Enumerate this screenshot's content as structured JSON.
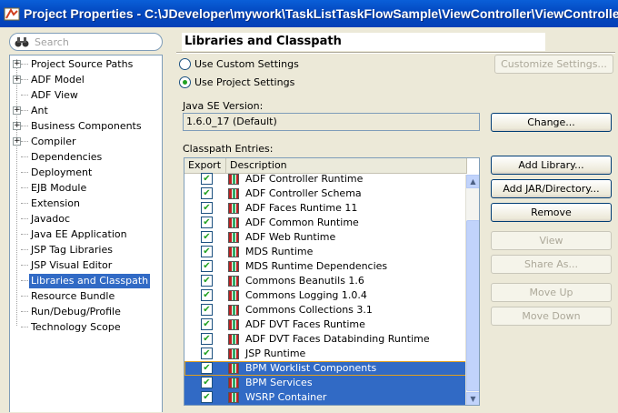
{
  "window": {
    "title": "Project Properties - C:\\JDeveloper\\mywork\\TaskListTaskFlowSample\\ViewController\\ViewController.jpr"
  },
  "search": {
    "placeholder": "Search"
  },
  "tree": [
    {
      "label": "Project Source Paths",
      "expandable": true
    },
    {
      "label": "ADF Model",
      "expandable": true
    },
    {
      "label": "ADF View",
      "expandable": false
    },
    {
      "label": "Ant",
      "expandable": true
    },
    {
      "label": "Business Components",
      "expandable": true
    },
    {
      "label": "Compiler",
      "expandable": true
    },
    {
      "label": "Dependencies",
      "expandable": false
    },
    {
      "label": "Deployment",
      "expandable": false
    },
    {
      "label": "EJB Module",
      "expandable": false
    },
    {
      "label": "Extension",
      "expandable": false
    },
    {
      "label": "Javadoc",
      "expandable": false
    },
    {
      "label": "Java EE Application",
      "expandable": false
    },
    {
      "label": "JSP Tag Libraries",
      "expandable": false
    },
    {
      "label": "JSP Visual Editor",
      "expandable": false
    },
    {
      "label": "Libraries and Classpath",
      "expandable": false,
      "selected": true
    },
    {
      "label": "Resource Bundle",
      "expandable": false
    },
    {
      "label": "Run/Debug/Profile",
      "expandable": false
    },
    {
      "label": "Technology Scope",
      "expandable": false
    }
  ],
  "panel": {
    "heading": "Libraries and Classpath",
    "use_custom": "Use Custom Settings",
    "use_project": "Use Project Settings",
    "customize_button": "Customize Settings...",
    "java_se_label": "Java SE Version:",
    "java_se_value": "1.6.0_17 (Default)",
    "change_button": "Change...",
    "classpath_label": "Classpath Entries:",
    "col_export": "Export",
    "col_description": "Description",
    "buttons": {
      "add_library": "Add Library...",
      "add_jar": "Add JAR/Directory...",
      "remove": "Remove",
      "view": "View",
      "share_as": "Share As...",
      "move_up": "Move Up",
      "move_down": "Move Down"
    },
    "entries": [
      {
        "label": "ADF Controller Runtime",
        "checked": true,
        "selected": false
      },
      {
        "label": "ADF Controller Schema",
        "checked": true,
        "selected": false
      },
      {
        "label": "ADF Faces Runtime 11",
        "checked": true,
        "selected": false
      },
      {
        "label": "ADF Common Runtime",
        "checked": true,
        "selected": false
      },
      {
        "label": "ADF Web Runtime",
        "checked": true,
        "selected": false
      },
      {
        "label": "MDS Runtime",
        "checked": true,
        "selected": false
      },
      {
        "label": "MDS Runtime Dependencies",
        "checked": true,
        "selected": false
      },
      {
        "label": "Commons Beanutils 1.6",
        "checked": true,
        "selected": false
      },
      {
        "label": "Commons Logging 1.0.4",
        "checked": true,
        "selected": false
      },
      {
        "label": "Commons Collections 3.1",
        "checked": true,
        "selected": false
      },
      {
        "label": "ADF DVT Faces Runtime",
        "checked": true,
        "selected": false
      },
      {
        "label": "ADF DVT Faces Databinding Runtime",
        "checked": true,
        "selected": false
      },
      {
        "label": "JSP Runtime",
        "checked": true,
        "selected": false
      },
      {
        "label": "BPM Worklist Components",
        "checked": true,
        "selected": true
      },
      {
        "label": "BPM Services",
        "checked": true,
        "selected": true
      },
      {
        "label": "WSRP Container",
        "checked": true,
        "selected": true
      }
    ]
  },
  "colors": {
    "titlebar": "#0348c0",
    "selection": "#316ac5",
    "check": "#21a121"
  }
}
